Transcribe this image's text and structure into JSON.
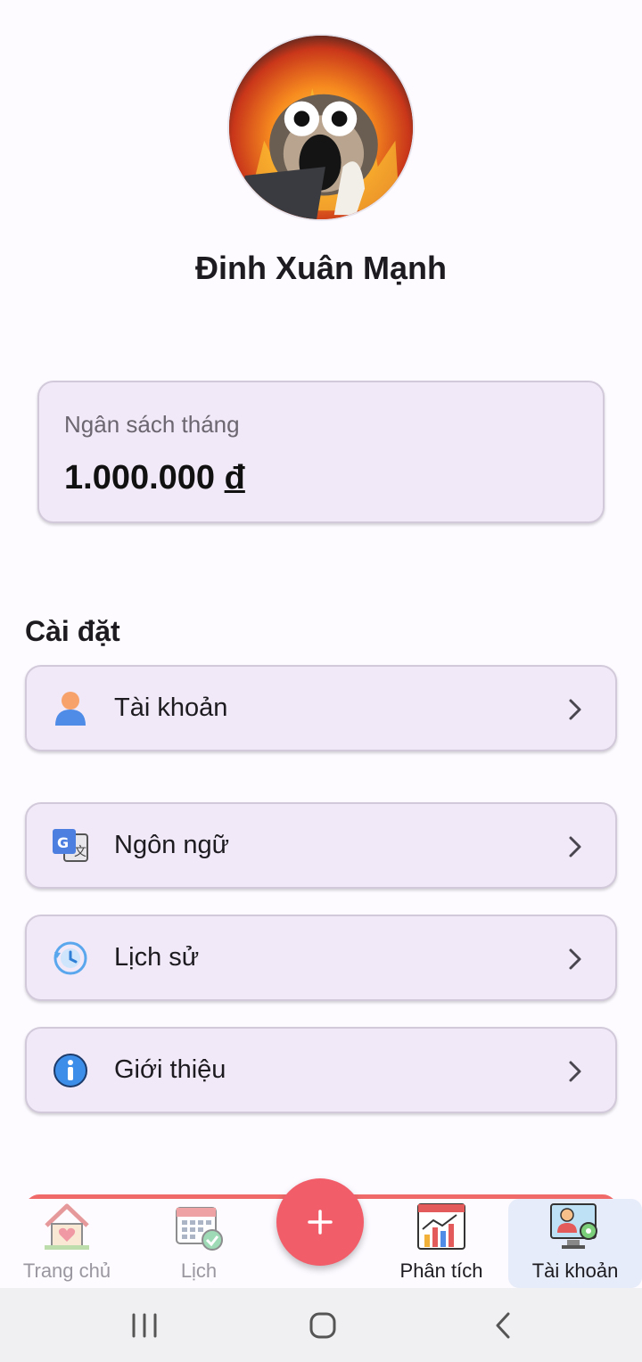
{
  "profile": {
    "name": "Đinh Xuân Mạnh"
  },
  "budget": {
    "label": "Ngân sách tháng",
    "amount": "1.000.000",
    "currency": "đ"
  },
  "settings": {
    "title": "Cài đặt",
    "items": [
      {
        "label": "Tài khoản",
        "icon": "user-icon"
      },
      {
        "label": "Ngôn ngữ",
        "icon": "translate-icon"
      },
      {
        "label": "Lịch sử",
        "icon": "history-icon"
      },
      {
        "label": "Giới thiệu",
        "icon": "info-icon"
      }
    ]
  },
  "nav": {
    "items": [
      {
        "label": "Trang chủ",
        "icon": "home-icon"
      },
      {
        "label": "Lịch",
        "icon": "calendar-icon"
      },
      {
        "label": "Phân tích",
        "icon": "analytics-icon"
      },
      {
        "label": "Tài khoản",
        "icon": "account-icon"
      }
    ],
    "fab_icon": "plus-icon",
    "selected": "Tài khoản"
  },
  "colors": {
    "card_bg": "#f1e9f7",
    "fab": "#f25d6a",
    "selected_tab_bg": "#e6ecf9"
  }
}
